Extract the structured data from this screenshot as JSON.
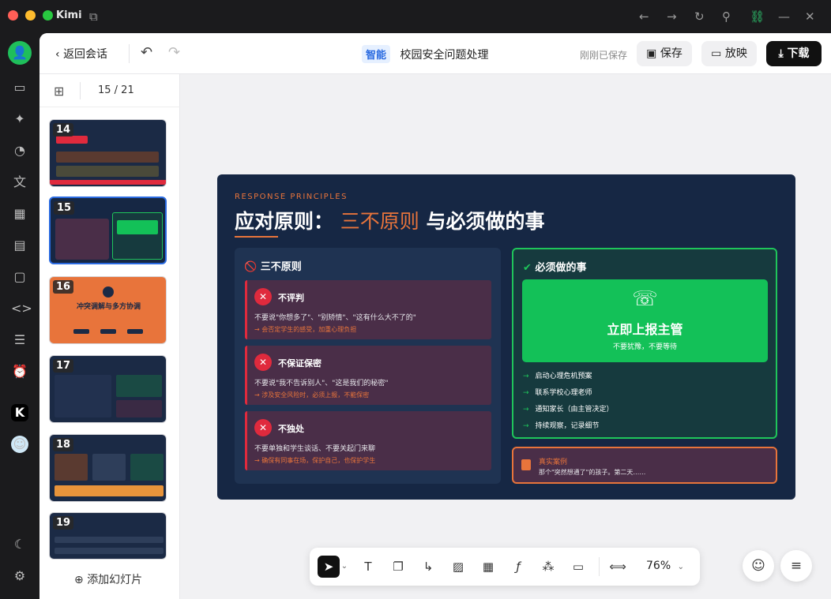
{
  "app": {
    "title": "Kimi"
  },
  "titlebar": {
    "icons": [
      "back-arrow-icon",
      "forward-arrow-icon",
      "refresh-icon",
      "pin-icon",
      "link-icon",
      "minimize-icon",
      "close-icon"
    ]
  },
  "rail": {
    "icons": [
      "user-avatar-icon",
      "chat-icon",
      "sparkle-icon",
      "palette-icon",
      "translate-icon",
      "apps-grid-icon",
      "file-search-icon",
      "folder-icon",
      "code-icon",
      "notebook-icon",
      "alarm-icon",
      "kimi-app-icon",
      "user-photo-icon",
      "moon-icon",
      "settings-icon"
    ]
  },
  "header": {
    "back_label": "返回会话",
    "tag": "智能",
    "doc_title": "校园安全问题处理",
    "saved_text": "刚刚已保存",
    "save_label": "保存",
    "present_label": "放映",
    "download_label": "下载"
  },
  "sidebar": {
    "counter": "15 / 21",
    "thumbs": [
      {
        "num": "14"
      },
      {
        "num": "15"
      },
      {
        "num": "16",
        "title": "冲突调解与多方协调"
      },
      {
        "num": "17"
      },
      {
        "num": "18"
      },
      {
        "num": "19"
      }
    ],
    "add_label": "添加幻灯片"
  },
  "slide": {
    "eyebrow": "RESPONSE PRINCIPLES",
    "title_a": "应对原则：",
    "title_highlight": "三不原则",
    "title_b": "与必须做的事",
    "left_head": "三不原则",
    "cards": [
      {
        "title": "不评判",
        "desc": "不要说\"你想多了\"、\"别矫情\"、\"这有什么大不了的\"",
        "warn": "会否定学生的感受，加重心理负担"
      },
      {
        "title": "不保证保密",
        "desc": "不要说\"我不告诉别人\"、\"这是我们的秘密\"",
        "warn": "涉及安全风险时，必须上报，不能保密"
      },
      {
        "title": "不独处",
        "desc": "不要单独和学生谈话、不要关起门来聊",
        "warn": "确保有同事在场，保护自己，也保护学生"
      }
    ],
    "right_head": "必须做的事",
    "report_title": "立即上报主管",
    "report_sub": "不要犹豫，不要等待",
    "actions": [
      "启动心理危机预案",
      "联系学校心理老师",
      "通知家长（由主管决定）",
      "持续观察，记录细节"
    ],
    "case_title": "真实案例",
    "case_text": "那个\"突然想通了\"的孩子。第二天……"
  },
  "toolbar": {
    "tools": [
      "pointer-icon",
      "text-icon",
      "shape-icon",
      "connector-icon",
      "image-icon",
      "table-icon",
      "formula-icon",
      "elements-icon",
      "media-icon",
      "fit-icon"
    ],
    "zoom": "76%"
  },
  "colors": {
    "accent": "#e8743b",
    "danger": "#e02a3d",
    "success": "#13c158",
    "slide_bg": "#162744",
    "brand_blue": "#2a6ae0"
  }
}
